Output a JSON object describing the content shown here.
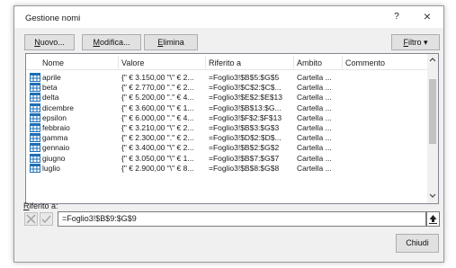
{
  "dialog": {
    "title": "Gestione nomi",
    "help_label": "?",
    "close_label": "×"
  },
  "toolbar": {
    "new_prefix": "N",
    "new_rest": "uovo...",
    "edit_prefix": "M",
    "edit_rest": "odifica...",
    "delete_prefix": "E",
    "delete_rest": "limina",
    "filter_prefix": "F",
    "filter_rest": "iltro",
    "filter_arrow": "▾"
  },
  "table": {
    "headers": {
      "name": "Nome",
      "value": "Valore",
      "refers_to": "Riferito a",
      "scope": "Ambito",
      "comment": "Commento"
    },
    "rows": [
      {
        "name": "aprile",
        "value": "{\" € 3.150,00 \"\\\" € 2...",
        "refers_to": "=Foglio3!$B$5:$G$5",
        "scope": "Cartella ...",
        "comment": ""
      },
      {
        "name": "beta",
        "value": "{\" € 2.770,00 \".\" € 2...",
        "refers_to": "=Foglio3!$C$2:$C$...",
        "scope": "Cartella ...",
        "comment": ""
      },
      {
        "name": "delta",
        "value": "{\" € 5.200,00 \".\" € 4...",
        "refers_to": "=Foglio3!$E$2:$E$13",
        "scope": "Cartella ...",
        "comment": ""
      },
      {
        "name": "dicembre",
        "value": "{\" € 3.600,00 \"\\\" € 1...",
        "refers_to": "=Foglio3!$B$13:$G...",
        "scope": "Cartella ...",
        "comment": ""
      },
      {
        "name": "epsilon",
        "value": "{\" € 6.000,00 \".\" € 4...",
        "refers_to": "=Foglio3!$F$2:$F$13",
        "scope": "Cartella ...",
        "comment": ""
      },
      {
        "name": "febbraio",
        "value": "{\" € 3.210,00 \"\\\" € 2...",
        "refers_to": "=Foglio3!$B$3:$G$3",
        "scope": "Cartella ...",
        "comment": ""
      },
      {
        "name": "gamma",
        "value": "{\" € 2.300,00 \".\" € 2...",
        "refers_to": "=Foglio3!$D$2:$D$...",
        "scope": "Cartella ...",
        "comment": ""
      },
      {
        "name": "gennaio",
        "value": "{\" € 3.400,00 \"\\\" € 2...",
        "refers_to": "=Foglio3!$B$2:$G$2",
        "scope": "Cartella ...",
        "comment": ""
      },
      {
        "name": "giugno",
        "value": "{\" € 3.050,00 \"\\\" € 1...",
        "refers_to": "=Foglio3!$B$7:$G$7",
        "scope": "Cartella ...",
        "comment": ""
      },
      {
        "name": "luglio",
        "value": "{\" € 2.900,00 \"\\\" € 8...",
        "refers_to": "=Foglio3!$B$8:$G$8",
        "scope": "Cartella ...",
        "comment": ""
      }
    ]
  },
  "reference": {
    "label_prefix": "R",
    "label_rest": "iferito a:",
    "value": "=Foglio3!$B$9:$G$9"
  },
  "footer": {
    "close_label": "Chiudi"
  },
  "icons": {
    "row_icon": "named-range-table-icon",
    "cancel": "cross-icon",
    "confirm": "check-icon",
    "collapse": "collapse-dialog-icon",
    "scroll_up": "chevron-up-icon",
    "scroll_down": "chevron-down-icon"
  },
  "colors": {
    "table_icon": "#1f6fb5",
    "disabled_icon": "#a9a9a9",
    "focus_border": "#0078d7"
  }
}
